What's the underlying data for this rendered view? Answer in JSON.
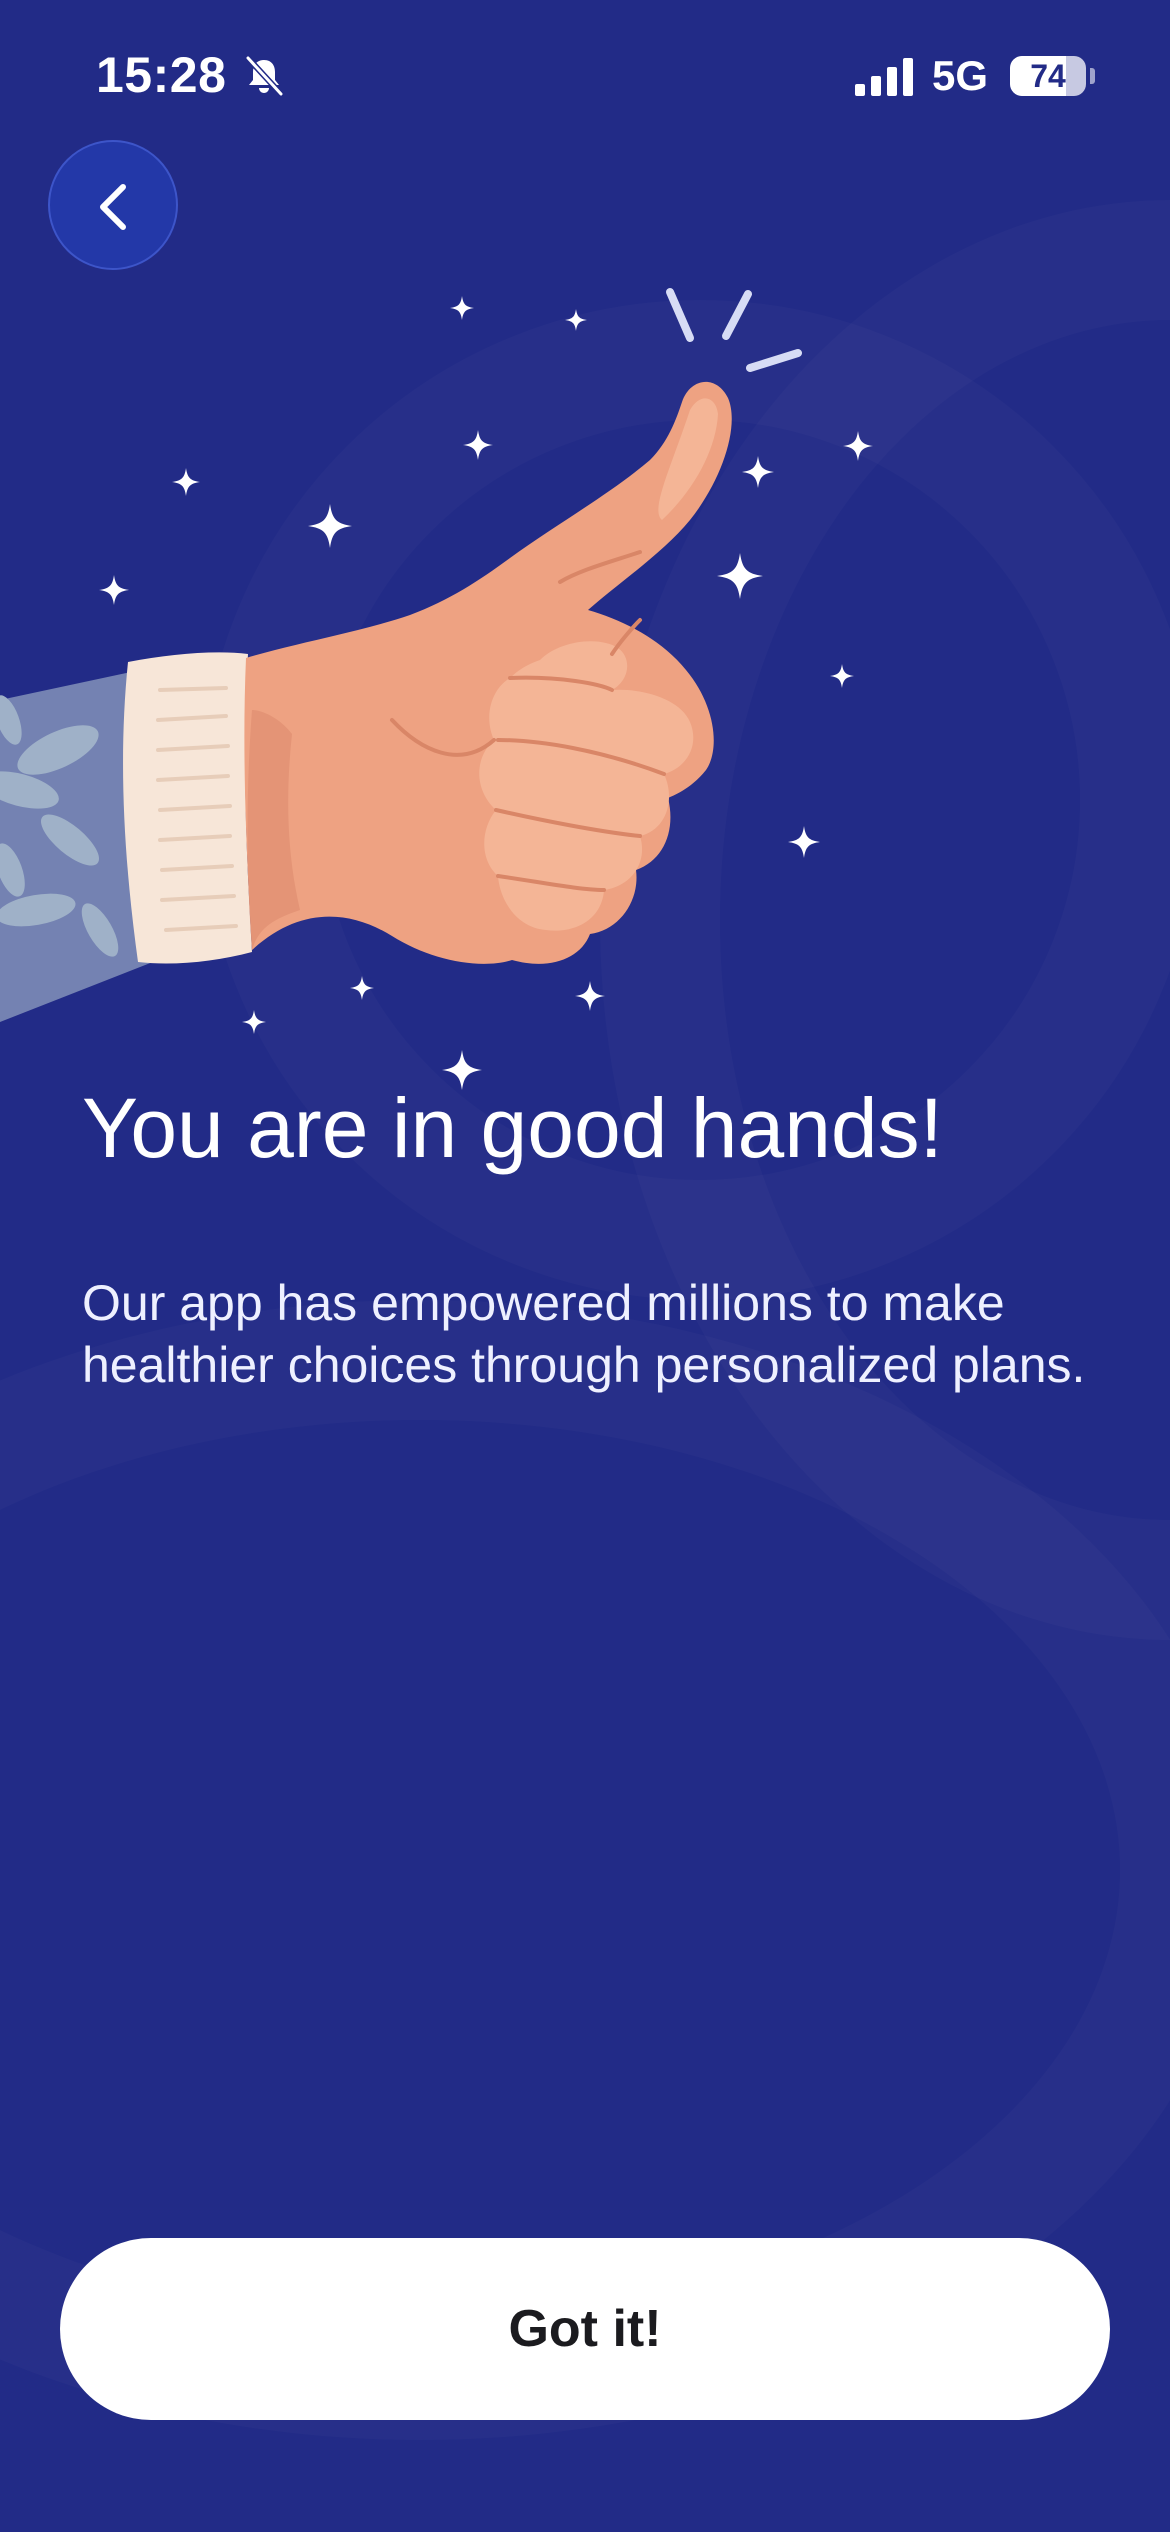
{
  "status_bar": {
    "time": "15:28",
    "network": "5G",
    "battery_level": "74",
    "battery_fraction": 0.74,
    "icons": [
      "bell-muted-icon",
      "signal-icon",
      "battery-icon"
    ]
  },
  "navigation": {
    "back_icon": "chevron-left-icon"
  },
  "illustration": {
    "subject": "thumbs-up-hand-illustration"
  },
  "content": {
    "headline": "You are in good hands!",
    "body": "Our app has empowered millions to make healthier choices through personalized plans."
  },
  "actions": {
    "primary_label": "Got it!"
  },
  "colors": {
    "background": "#222b87",
    "button_bg": "#ffffff",
    "button_text": "#1b1b1f",
    "back_button_bg": "#2338a8",
    "skin": "#eea282",
    "sleeve": "#f7e6d8"
  }
}
